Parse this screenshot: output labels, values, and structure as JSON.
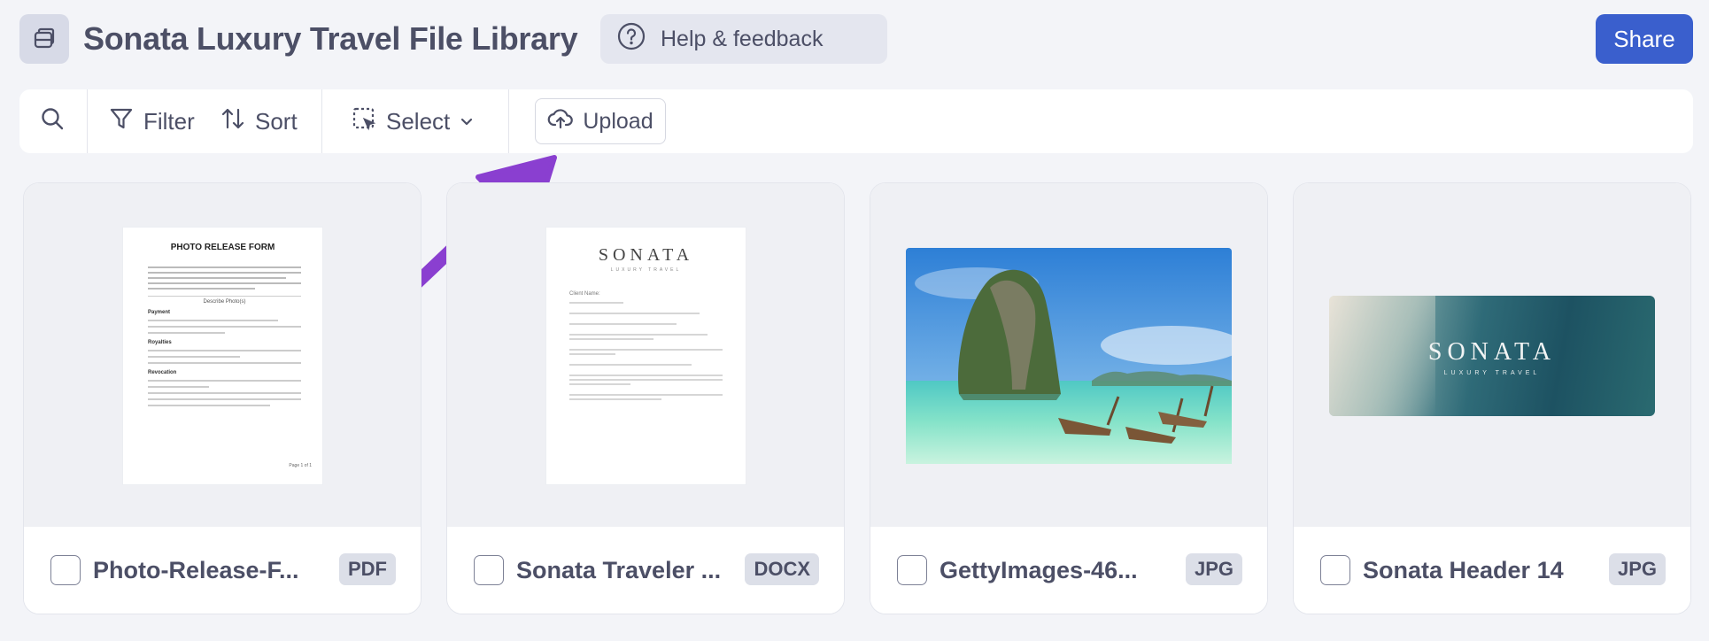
{
  "header": {
    "title": "Sonata Luxury Travel File Library",
    "help_label": "Help & feedback",
    "share_label": "Share"
  },
  "toolbar": {
    "filter_label": "Filter",
    "sort_label": "Sort",
    "select_label": "Select",
    "upload_label": "Upload"
  },
  "files": [
    {
      "name": "Photo-Release-F...",
      "type": "PDF",
      "preview": {
        "heading": "PHOTO RELEASE FORM",
        "section": "Describe Photo(s)",
        "labels": [
          "Payment",
          "Royalties",
          "Revocation"
        ],
        "footer": "Page 1 of 1"
      }
    },
    {
      "name": "Sonata Traveler ...",
      "type": "DOCX",
      "preview": {
        "brand": "SONATA",
        "tagline": "LUXURY TRAVEL",
        "client_label": "Client Name:"
      }
    },
    {
      "name": "GettyImages-46...",
      "type": "JPG"
    },
    {
      "name": "Sonata Header 14",
      "type": "JPG",
      "preview": {
        "brand": "SONATA",
        "tagline": "LUXURY TRAVEL"
      }
    }
  ],
  "colors": {
    "accent": "#3a5fcd",
    "background": "#f3f4f8",
    "annotation_arrow": "#8a3fd0"
  }
}
